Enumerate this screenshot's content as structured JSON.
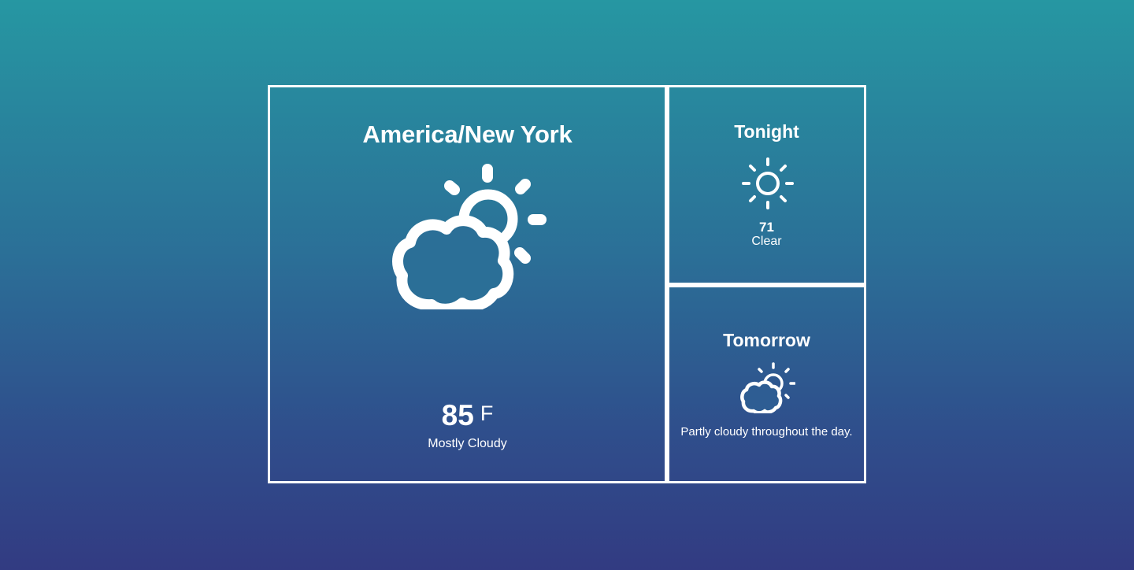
{
  "current": {
    "location": "America/New York",
    "icon": "partly-cloudy-icon",
    "temperature": "85",
    "unit": "F",
    "summary": "Mostly Cloudy"
  },
  "tonight": {
    "title": "Tonight",
    "icon": "sun-icon",
    "temperature": "71",
    "summary": "Clear"
  },
  "tomorrow": {
    "title": "Tomorrow",
    "icon": "partly-cloudy-icon",
    "summary": "Partly cloudy throughout the day."
  },
  "colors": {
    "gradient_top": "#2697a2",
    "gradient_bottom": "#323b82",
    "foreground": "#ffffff"
  }
}
